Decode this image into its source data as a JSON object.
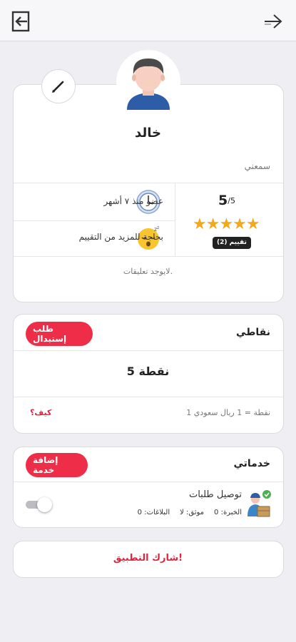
{
  "colors": {
    "accent": "#ee2e48",
    "star": "#f4a81c",
    "background": "#eeeef3"
  },
  "topbar": {
    "left_icon": "logout-icon",
    "right_icon": "forward-arrow-icon"
  },
  "profile": {
    "name": "خالد",
    "city": "سمعني",
    "rating_value": "5",
    "rating_max": "/5",
    "stars": 5,
    "stars_text": "★★★★★",
    "rating_count": "(2) تقييم",
    "member_since": "عضو منذ ٧ أشهر",
    "needs_rating": "بحاجة للمزيد من التقييم",
    "no_comments": "لايوجد تعليقات."
  },
  "points": {
    "title": "نقاطي",
    "redeem_label": "طلب إستبدال",
    "value": "5 نقطة",
    "rate": "1 نقطة = 1 ريال سعودي",
    "how_label": "كيف؟"
  },
  "services": {
    "title": "خدماتي",
    "add_label": "إضافة خدمة",
    "items": [
      {
        "name": "توصيل طلبات",
        "experience": "الخبرة: 0",
        "verified": "موثق: لا",
        "reports": "البلاغات: 0",
        "enabled": false
      }
    ]
  },
  "share": {
    "label": "شارك التطبيق!"
  }
}
